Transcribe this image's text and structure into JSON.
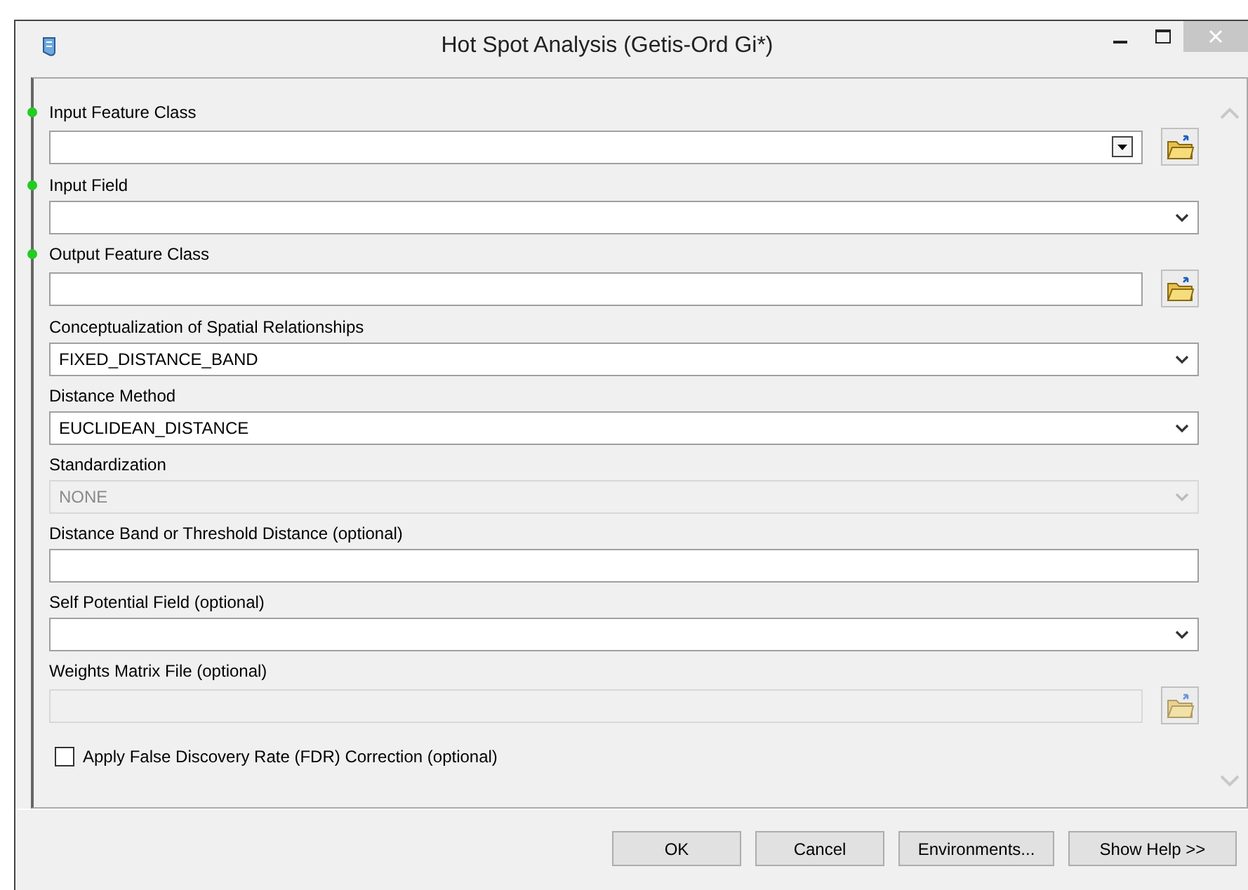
{
  "window": {
    "title": "Hot Spot Analysis (Getis-Ord Gi*)"
  },
  "parameters": [
    {
      "label": "Input Feature Class",
      "required": true,
      "kind": "combo-browse",
      "disabled": false
    },
    {
      "label": "Input Field",
      "required": true,
      "kind": "dropdown",
      "disabled": false
    },
    {
      "label": "Output Feature Class",
      "required": true,
      "kind": "text-browse",
      "disabled": false
    },
    {
      "label": "Conceptualization of Spatial Relationships",
      "required": false,
      "kind": "dropdown",
      "disabled": false,
      "value": "FIXED_DISTANCE_BAND"
    },
    {
      "label": "Distance Method",
      "required": false,
      "kind": "dropdown",
      "disabled": false,
      "value": "EUCLIDEAN_DISTANCE"
    },
    {
      "label": "Standardization",
      "required": false,
      "kind": "dropdown",
      "disabled": true,
      "value": "NONE"
    },
    {
      "label": "Distance Band or Threshold Distance (optional)",
      "required": false,
      "kind": "text",
      "disabled": false
    },
    {
      "label": "Self Potential Field (optional)",
      "required": false,
      "kind": "dropdown",
      "disabled": false
    },
    {
      "label": "Weights Matrix File (optional)",
      "required": false,
      "kind": "text-browse",
      "disabled": true
    }
  ],
  "fdr": {
    "label": "Apply False Discovery Rate (FDR) Correction (optional)",
    "checked": false
  },
  "buttons": [
    "OK",
    "Cancel",
    "Environments...",
    "Show Help >>"
  ]
}
